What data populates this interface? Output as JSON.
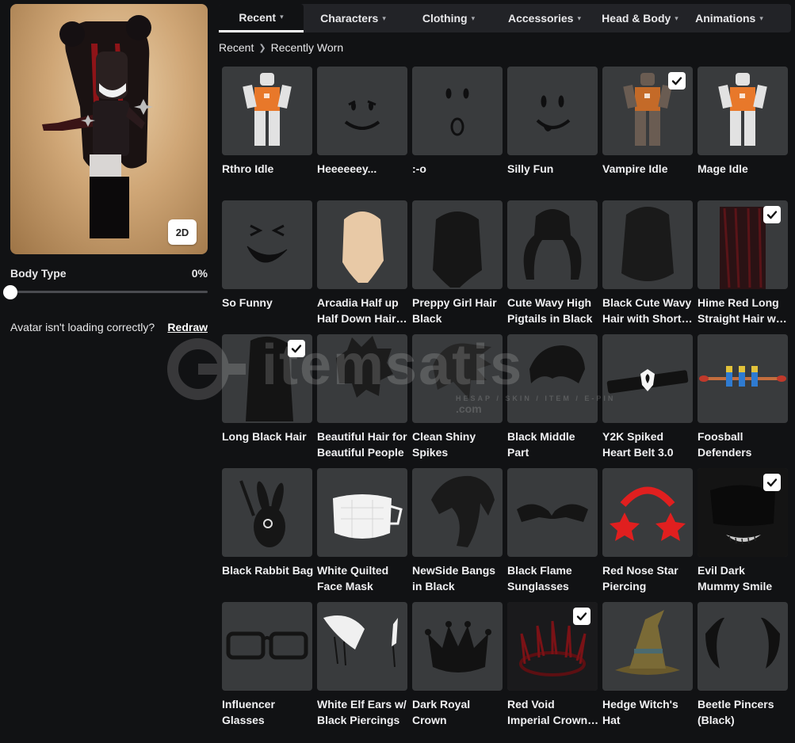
{
  "preview": {
    "toggle_label": "2D"
  },
  "body_type": {
    "label": "Body Type",
    "value": "0%",
    "level": 0
  },
  "loading": {
    "text": "Avatar isn't loading correctly?",
    "link": "Redraw"
  },
  "tabs": [
    {
      "label": "Recent",
      "active": true
    },
    {
      "label": "Characters"
    },
    {
      "label": "Clothing"
    },
    {
      "label": "Accessories"
    },
    {
      "label": "Head & Body"
    },
    {
      "label": "Animations"
    }
  ],
  "breadcrumb": {
    "root": "Recent",
    "current": "Recently Worn"
  },
  "watermark": {
    "brand": "itemsatis",
    "tagline": "HESAP / SKIN / ITEM / E-PIN",
    "domain": ".com"
  },
  "items": [
    {
      "name": "Rthro Idle",
      "kind": "figure-orange",
      "checked": false
    },
    {
      "name": "Heeeeeey...",
      "kind": "face-hey",
      "checked": false
    },
    {
      "name": ":-o",
      "kind": "face-o",
      "checked": false
    },
    {
      "name": "Silly Fun",
      "kind": "face-silly",
      "checked": false
    },
    {
      "name": "Vampire Idle",
      "kind": "figure-orange-dark",
      "checked": true
    },
    {
      "name": "Mage Idle",
      "kind": "figure-orange-arms",
      "checked": false
    },
    {
      "name": "So Funny",
      "kind": "face-funny",
      "checked": false
    },
    {
      "name": "Arcadia Half up Half Down Hair in Blonde",
      "kind": "hair-blonde",
      "checked": false
    },
    {
      "name": "Preppy Girl Hair Black",
      "kind": "hair-black",
      "checked": false
    },
    {
      "name": "Cute Wavy High Pigtails in Black",
      "kind": "hair-pigtails",
      "checked": false
    },
    {
      "name": "Black Cute Wavy Hair with Short Bangs",
      "kind": "hair-wavy",
      "checked": false
    },
    {
      "name": "Hime Red Long Straight Hair with Bangs",
      "kind": "hair-red",
      "checked": true
    },
    {
      "name": "Long Black Hair",
      "kind": "hair-long",
      "checked": true
    },
    {
      "name": "Beautiful Hair for Beautiful People",
      "kind": "hair-spiky",
      "checked": false
    },
    {
      "name": "Clean Shiny Spikes",
      "kind": "hair-shiny",
      "checked": false
    },
    {
      "name": "Black Middle Part",
      "kind": "hair-middle",
      "checked": false
    },
    {
      "name": "Y2K Spiked Heart Belt 3.0",
      "kind": "belt",
      "checked": false
    },
    {
      "name": "Foosball Defenders",
      "kind": "foosball",
      "checked": false
    },
    {
      "name": "Black Rabbit Bag",
      "kind": "rabbit",
      "checked": false
    },
    {
      "name": "White Quilted Face Mask",
      "kind": "mask",
      "checked": false
    },
    {
      "name": "NewSide Bangs in Black",
      "kind": "bangs",
      "checked": false
    },
    {
      "name": "Black Flame Sunglasses",
      "kind": "sunglasses",
      "checked": false
    },
    {
      "name": "Red Nose Star Piercing",
      "kind": "piercing",
      "checked": false
    },
    {
      "name": "Evil Dark Mummy Smile",
      "kind": "mummy",
      "checked": true
    },
    {
      "name": "Influencer Glasses",
      "kind": "glasses",
      "checked": false
    },
    {
      "name": "White Elf Ears w/ Black Piercings",
      "kind": "elf",
      "checked": false
    },
    {
      "name": "Dark Royal Crown",
      "kind": "crown",
      "checked": false
    },
    {
      "name": "Red Void Imperial Crown of Thorns",
      "kind": "thorns",
      "checked": true
    },
    {
      "name": "Hedge Witch's Hat",
      "kind": "witch",
      "checked": false
    },
    {
      "name": "Beetle Pincers (Black)",
      "kind": "pincers",
      "checked": false
    }
  ]
}
